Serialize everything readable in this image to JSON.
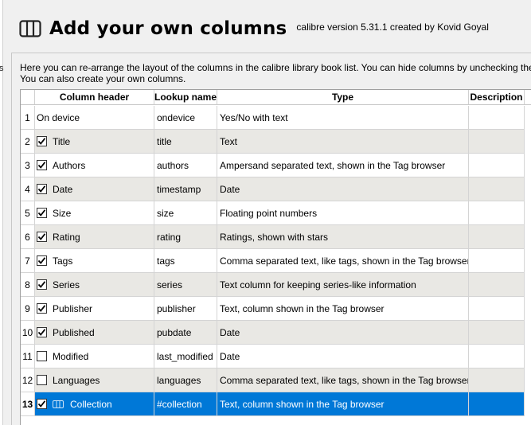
{
  "header": {
    "icon": "columns-icon",
    "title": "Add your own columns",
    "version": "calibre version 5.31.1 created by Kovid Goyal"
  },
  "description": "Here you can re-arrange the layout of the columns in the calibre library book list. You can hide columns by unchecking them. You can also create your own columns.",
  "table": {
    "columns": [
      "Column header",
      "Lookup name",
      "Type",
      "Description"
    ],
    "rows": [
      {
        "num": "1",
        "checked": null,
        "header": "On device",
        "lookup": "ondevice",
        "type": "Yes/No with text"
      },
      {
        "num": "2",
        "checked": true,
        "header": "Title",
        "lookup": "title",
        "type": "Text"
      },
      {
        "num": "3",
        "checked": true,
        "header": "Authors",
        "lookup": "authors",
        "type": "Ampersand separated text, shown in the Tag browser"
      },
      {
        "num": "4",
        "checked": true,
        "header": "Date",
        "lookup": "timestamp",
        "type": "Date"
      },
      {
        "num": "5",
        "checked": true,
        "header": "Size",
        "lookup": "size",
        "type": "Floating point numbers"
      },
      {
        "num": "6",
        "checked": true,
        "header": "Rating",
        "lookup": "rating",
        "type": "Ratings, shown with stars"
      },
      {
        "num": "7",
        "checked": true,
        "header": "Tags",
        "lookup": "tags",
        "type": "Comma separated text, like tags, shown in the Tag browser"
      },
      {
        "num": "8",
        "checked": true,
        "header": "Series",
        "lookup": "series",
        "type": "Text column for keeping series-like information"
      },
      {
        "num": "9",
        "checked": true,
        "header": "Publisher",
        "lookup": "publisher",
        "type": "Text, column shown in the Tag browser"
      },
      {
        "num": "10",
        "checked": true,
        "header": "Published",
        "lookup": "pubdate",
        "type": "Date"
      },
      {
        "num": "11",
        "checked": false,
        "header": "Modified",
        "lookup": "last_modified",
        "type": "Date"
      },
      {
        "num": "12",
        "checked": false,
        "header": "Languages",
        "lookup": "languages",
        "type": "Comma separated text, like tags, shown in the Tag browser"
      },
      {
        "num": "13",
        "checked": true,
        "header": "Collection",
        "lookup": "#collection",
        "type": "Text, column shown in the Tag browser",
        "selected": true,
        "icon": "custom-column-icon"
      }
    ]
  },
  "colors": {
    "selection": "#0078d7",
    "alt_row": "#e9e8e4",
    "background": "#f0f0f0"
  }
}
